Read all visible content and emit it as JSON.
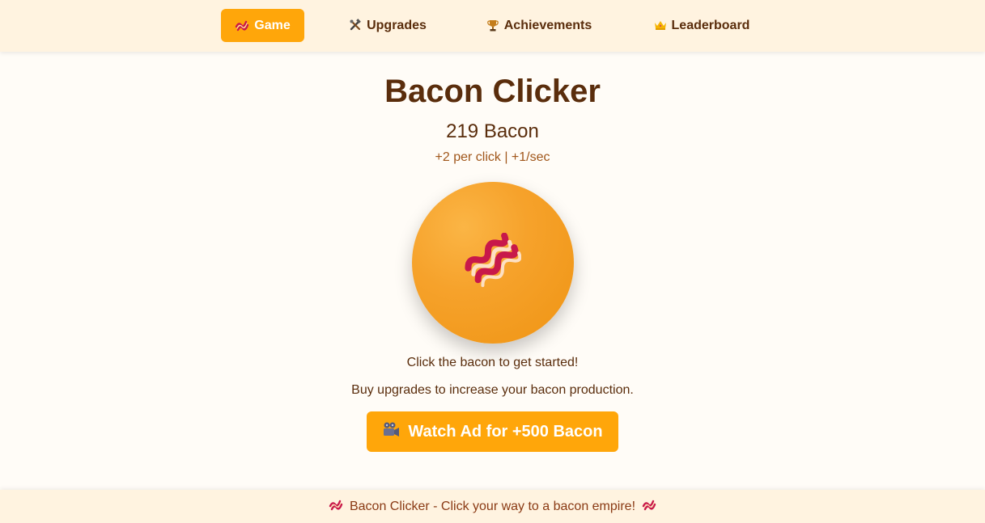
{
  "nav": {
    "items": [
      {
        "label": "Game",
        "icon": "bacon-icon",
        "active": true
      },
      {
        "label": "Upgrades",
        "icon": "tools-icon",
        "active": false
      },
      {
        "label": "Achievements",
        "icon": "trophy-icon",
        "active": false
      },
      {
        "label": "Leaderboard",
        "icon": "crown-icon",
        "active": false
      }
    ]
  },
  "game": {
    "title": "Bacon Clicker",
    "count": "219 Bacon",
    "rate": "+2 per click | +1/sec",
    "click_icon": "bacon-icon",
    "hint": "Click the bacon to get started!",
    "hint2": "Buy upgrades to increase your bacon production.",
    "ad_button_label": "Watch Ad for +500 Bacon",
    "ad_icon": "movie-camera-icon"
  },
  "footer": {
    "text": "Bacon Clicker - Click your way to a bacon empire!"
  },
  "colors": {
    "accent": "#ffa60a",
    "header_bg": "#fff3e0",
    "text": "#5a2d0c",
    "bacon": "#c8184a"
  }
}
